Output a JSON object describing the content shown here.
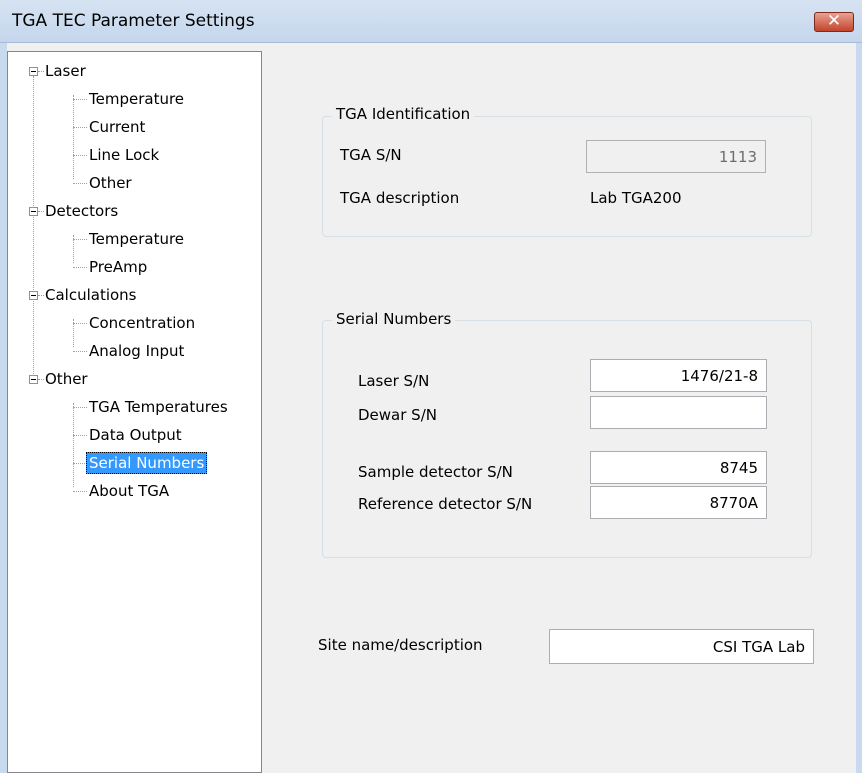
{
  "window": {
    "title": "TGA TEC Parameter Settings",
    "close_glyph": "✕"
  },
  "tree": {
    "laser": "Laser",
    "laser_temperature": "Temperature",
    "laser_current": "Current",
    "laser_line_lock": "Line Lock",
    "laser_other": "Other",
    "detectors": "Detectors",
    "detectors_temperature": "Temperature",
    "detectors_preamp": "PreAmp",
    "calculations": "Calculations",
    "calc_concentration": "Concentration",
    "calc_analog_input": "Analog Input",
    "other": "Other",
    "other_tga_temperatures": "TGA Temperatures",
    "other_data_output": "Data Output",
    "other_serial_numbers": "Serial Numbers",
    "other_about_tga": "About TGA"
  },
  "tga_identification": {
    "group_label": "TGA Identification",
    "sn_label": "TGA S/N",
    "sn_value": "1113",
    "description_label": "TGA description",
    "description_value": "Lab TGA200"
  },
  "serial_numbers": {
    "group_label": "Serial Numbers",
    "laser_label": "Laser S/N",
    "laser_value": "1476/21-8",
    "dewar_label": "Dewar S/N",
    "dewar_value": "",
    "sample_label": "Sample detector S/N",
    "sample_value": "8745",
    "reference_label": "Reference detector S/N",
    "reference_value": "8770A"
  },
  "site": {
    "label": "Site name/description",
    "value": "CSI TGA Lab"
  }
}
